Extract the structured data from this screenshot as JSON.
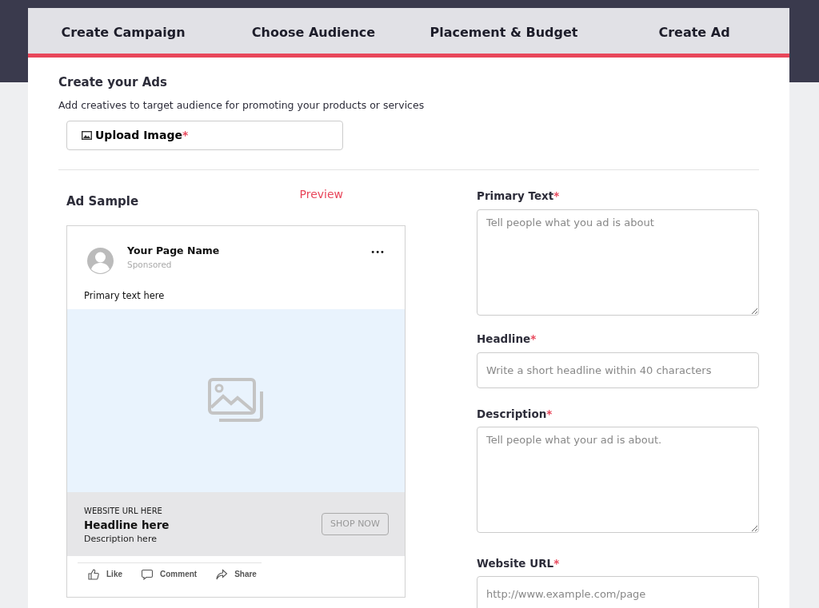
{
  "steps": [
    {
      "label": "Create Campaign"
    },
    {
      "label": "Choose Audience"
    },
    {
      "label": "Placement & Budget"
    },
    {
      "label": "Create Ad"
    }
  ],
  "section": {
    "title": "Create your Ads",
    "subtitle": "Add creatives to target audience for promoting your products or services",
    "upload": {
      "label": "Upload Image",
      "mark": "*"
    }
  },
  "ad_sample": {
    "title": "Ad Sample",
    "preview_link": "Preview",
    "page_name": "Your Page Name",
    "sponsored": "Sponsored",
    "menu": "•••",
    "primary_text": "Primary text here",
    "url": "WEBSITE URL HERE",
    "headline": "Headline here",
    "description": "Description here",
    "cta": "SHOP NOW",
    "actions": [
      {
        "kind": "like",
        "label": "Like"
      },
      {
        "kind": "comment",
        "label": "Comment"
      },
      {
        "kind": "share",
        "label": "Share"
      }
    ]
  },
  "fields": [
    {
      "kind": "textarea",
      "label": "Primary Text",
      "mark": "*",
      "placeholder": "Tell people what you ad is about"
    },
    {
      "kind": "input",
      "label": "Headline",
      "mark": "*",
      "placeholder": "Write a short headline within 40 characters"
    },
    {
      "kind": "textarea",
      "label": "Description",
      "mark": "*",
      "placeholder": "Tell people what your ad is about."
    },
    {
      "kind": "input",
      "label": "Website URL",
      "mark": "*",
      "placeholder": "http://www.example.com/page"
    }
  ]
}
